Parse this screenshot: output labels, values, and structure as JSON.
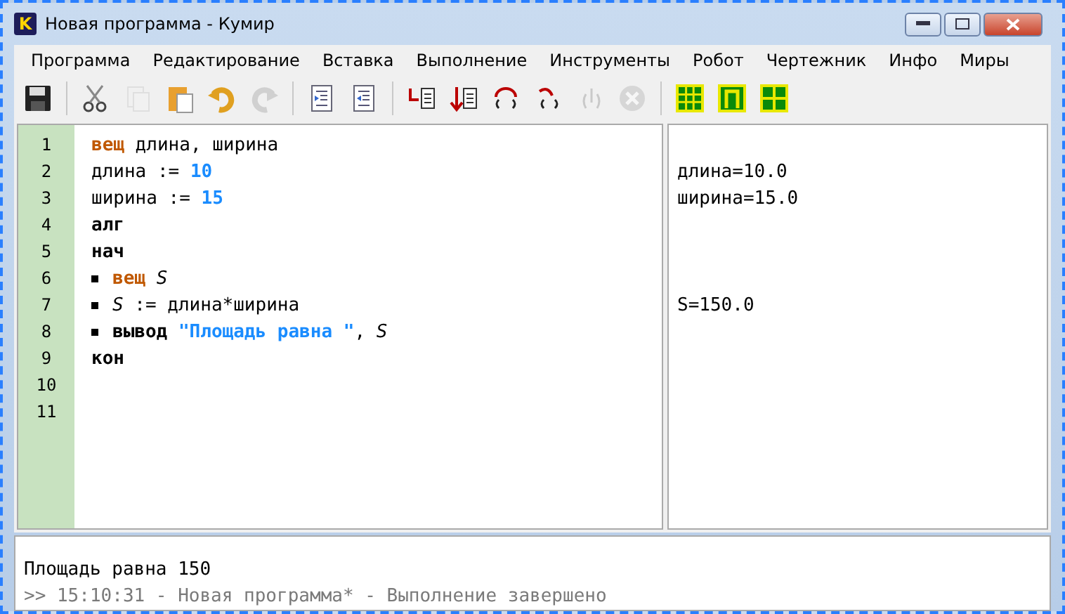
{
  "window": {
    "title": "Новая программа - Кумир",
    "app_icon": "K"
  },
  "menu": [
    "Программа",
    "Редактирование",
    "Вставка",
    "Выполнение",
    "Инструменты",
    "Робот",
    "Чертежник",
    "Инфо",
    "Миры"
  ],
  "toolbar": [
    [
      {
        "kind": "save",
        "disabled": false
      }
    ],
    [
      {
        "kind": "cut",
        "disabled": false
      },
      {
        "kind": "copy",
        "disabled": true
      },
      {
        "kind": "paste",
        "disabled": false
      },
      {
        "kind": "undo",
        "disabled": false
      },
      {
        "kind": "redo",
        "disabled": true
      }
    ],
    [
      {
        "kind": "indent",
        "disabled": false
      },
      {
        "kind": "unindent",
        "disabled": false
      }
    ],
    [
      {
        "kind": "run",
        "disabled": false
      },
      {
        "kind": "run-down",
        "disabled": false
      },
      {
        "kind": "step-over",
        "disabled": false
      },
      {
        "kind": "step-in",
        "disabled": false
      },
      {
        "kind": "step-out",
        "disabled": true
      },
      {
        "kind": "stop",
        "disabled": true
      }
    ],
    [
      {
        "kind": "grid",
        "disabled": false
      },
      {
        "kind": "frame",
        "disabled": false
      },
      {
        "kind": "cross",
        "disabled": false
      }
    ]
  ],
  "editor": {
    "lines": [
      {
        "number": "1",
        "indented": false,
        "tokens": [
          {
            "kind": "type",
            "text": "вещ"
          },
          {
            "kind": "plain",
            "text": " длина, ширина"
          }
        ]
      },
      {
        "number": "2",
        "indented": false,
        "margin": "длина=10.0",
        "tokens": [
          {
            "kind": "plain",
            "text": "длина := "
          },
          {
            "kind": "literal",
            "text": "10"
          }
        ]
      },
      {
        "number": "3",
        "indented": false,
        "margin": "ширина=15.0",
        "tokens": [
          {
            "kind": "plain",
            "text": "ширина := "
          },
          {
            "kind": "literal",
            "text": "15"
          }
        ]
      },
      {
        "number": "4",
        "indented": false,
        "tokens": [
          {
            "kind": "keyword",
            "text": "алг"
          }
        ]
      },
      {
        "number": "5",
        "indented": false,
        "tokens": [
          {
            "kind": "keyword",
            "text": "нач"
          }
        ]
      },
      {
        "number": "6",
        "indented": true,
        "tokens": [
          {
            "kind": "type",
            "text": "вещ "
          },
          {
            "kind": "variable",
            "text": "S"
          }
        ]
      },
      {
        "number": "7",
        "indented": true,
        "margin": "S=150.0",
        "tokens": [
          {
            "kind": "variable",
            "text": "S"
          },
          {
            "kind": "plain",
            "text": " := длина*ширина"
          }
        ]
      },
      {
        "number": "8",
        "indented": true,
        "tokens": [
          {
            "kind": "keyword",
            "text": "вывод "
          },
          {
            "kind": "literal",
            "text": "\"Площадь равна \""
          },
          {
            "kind": "plain",
            "text": ", "
          },
          {
            "kind": "variable",
            "text": "S"
          }
        ]
      },
      {
        "number": "9",
        "indented": false,
        "tokens": [
          {
            "kind": "keyword",
            "text": "кон"
          }
        ]
      },
      {
        "number": "10",
        "indented": false
      },
      {
        "number": "11",
        "indented": false
      }
    ]
  },
  "console": [
    {
      "kind": "output",
      "text": "Площадь равна 150"
    },
    {
      "kind": "status",
      "text": ">> 15:10:31 - Новая программа* - Выполнение завершено"
    }
  ]
}
